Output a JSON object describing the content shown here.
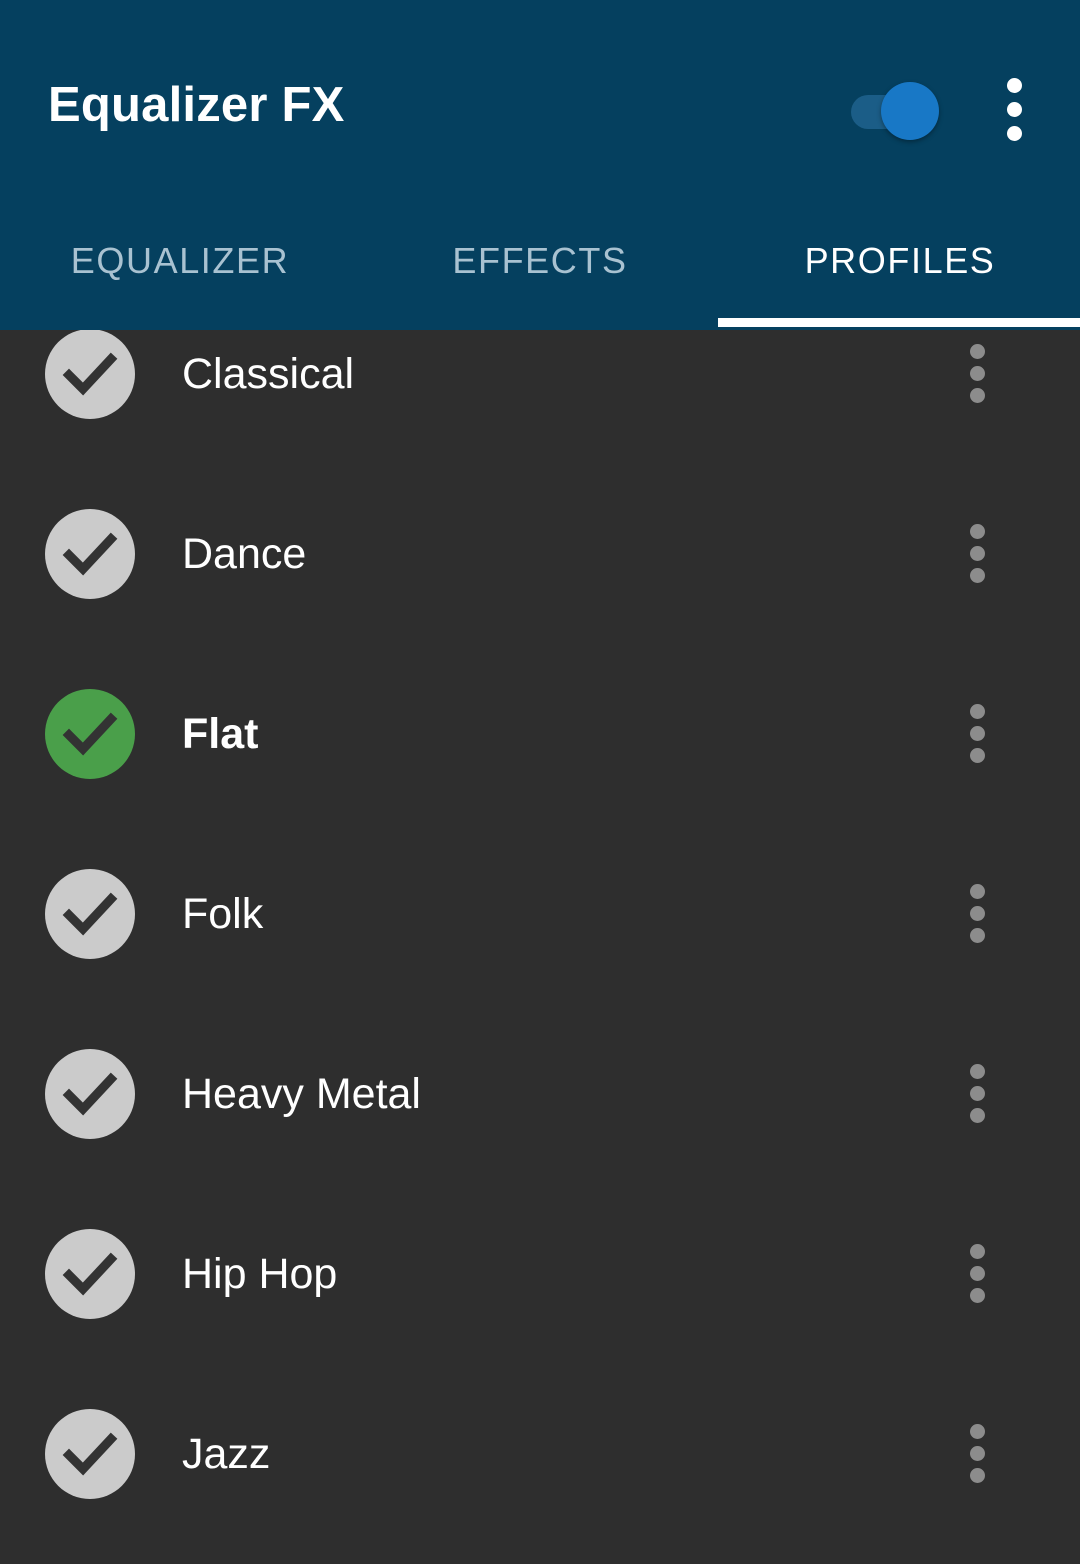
{
  "appbar": {
    "title": "Equalizer FX",
    "master_switch": {
      "name": "master-enable-switch",
      "state": "on"
    },
    "overflow_icon": "more-vertical-icon"
  },
  "tabs": [
    {
      "label": "EQUALIZER",
      "active": false
    },
    {
      "label": "EFFECTS",
      "active": false
    },
    {
      "label": "PROFILES",
      "active": true
    }
  ],
  "profiles": [
    {
      "label": "Classical",
      "selected": false,
      "check_icon": "check-icon",
      "overflow_icon": "more-vertical-icon"
    },
    {
      "label": "Dance",
      "selected": false,
      "check_icon": "check-icon",
      "overflow_icon": "more-vertical-icon"
    },
    {
      "label": "Flat",
      "selected": true,
      "check_icon": "check-icon",
      "overflow_icon": "more-vertical-icon"
    },
    {
      "label": "Folk",
      "selected": false,
      "check_icon": "check-icon",
      "overflow_icon": "more-vertical-icon"
    },
    {
      "label": "Heavy Metal",
      "selected": false,
      "check_icon": "check-icon",
      "overflow_icon": "more-vertical-icon"
    },
    {
      "label": "Hip Hop",
      "selected": false,
      "check_icon": "check-icon",
      "overflow_icon": "more-vertical-icon"
    },
    {
      "label": "Jazz",
      "selected": false,
      "check_icon": "check-icon",
      "overflow_icon": "more-vertical-icon"
    }
  ],
  "colors": {
    "appbar_blue": "#05405f",
    "list_background": "#2e2e2e",
    "selected_green": "#4a9f4a",
    "unselected_grey": "#cbcbcb",
    "switch_thumb_blue": "#1878c6",
    "switch_track_blue": "#1b5d87",
    "tab_active_text": "#ffffff",
    "tab_inactive_text": "#a9c2d1",
    "row_text": "#ffffff",
    "row_overflow_dot": "#8c8c8c"
  }
}
